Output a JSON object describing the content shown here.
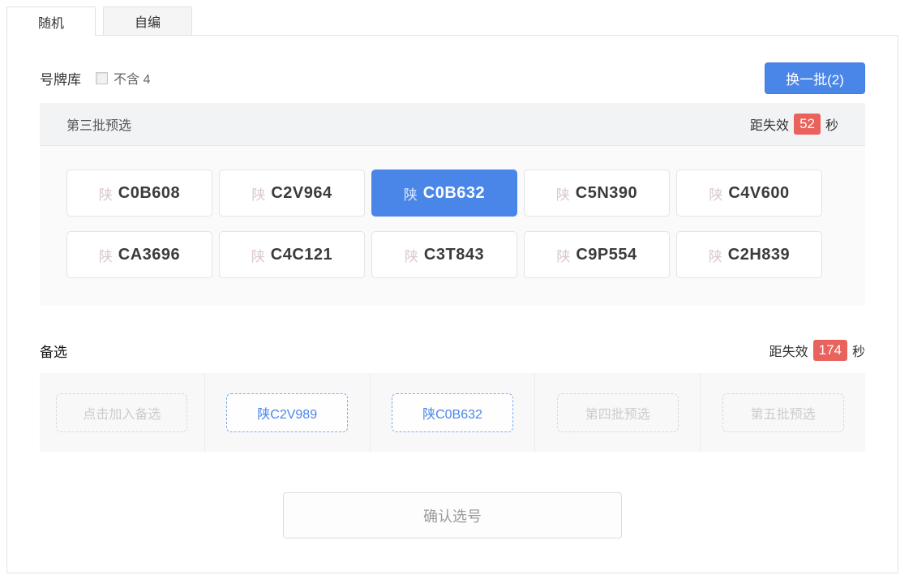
{
  "tabs": [
    {
      "label": "随机",
      "active": true
    },
    {
      "label": "自编",
      "active": false
    }
  ],
  "toolbar": {
    "library_label": "号牌库",
    "checkbox_label": "不含 4",
    "checkbox_checked": false,
    "change_batch_label": "换一批(2)"
  },
  "batch_section": {
    "title": "第三批预选",
    "countdown": {
      "prefix": "距失效",
      "seconds": "52",
      "suffix": "秒"
    },
    "plates": [
      {
        "province": "陕",
        "code": "C0B608",
        "selected": false
      },
      {
        "province": "陕",
        "code": "C2V964",
        "selected": false
      },
      {
        "province": "陕",
        "code": "C0B632",
        "selected": true
      },
      {
        "province": "陕",
        "code": "C5N390",
        "selected": false
      },
      {
        "province": "陕",
        "code": "C4V600",
        "selected": false
      },
      {
        "province": "陕",
        "code": "CA3696",
        "selected": false
      },
      {
        "province": "陕",
        "code": "C4C121",
        "selected": false
      },
      {
        "province": "陕",
        "code": "C3T843",
        "selected": false
      },
      {
        "province": "陕",
        "code": "C9P554",
        "selected": false
      },
      {
        "province": "陕",
        "code": "C2H839",
        "selected": false
      }
    ]
  },
  "alternatives_section": {
    "title": "备选",
    "countdown": {
      "prefix": "距失效",
      "seconds": "174",
      "suffix": "秒"
    },
    "slots": [
      {
        "label": "点击加入备选",
        "type": "empty"
      },
      {
        "label": "陕C2V989",
        "type": "filled"
      },
      {
        "label": "陕C0B632",
        "type": "filled"
      },
      {
        "label": "第四批预选",
        "type": "placeholder"
      },
      {
        "label": "第五批预选",
        "type": "placeholder"
      }
    ]
  },
  "confirm_button_label": "确认选号",
  "colors": {
    "accent": "#4a86e8",
    "danger": "#e9635c"
  }
}
